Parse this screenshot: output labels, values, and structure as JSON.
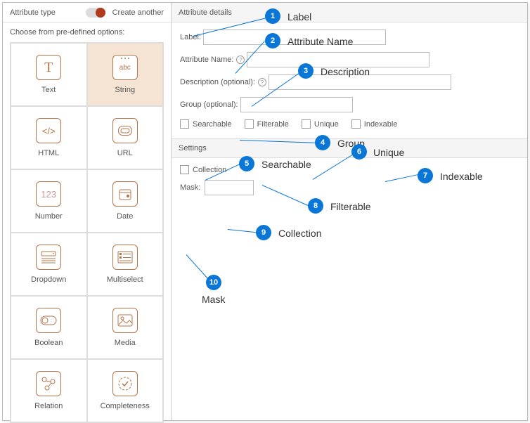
{
  "leftHeader": {
    "title": "Attribute type",
    "createAnother": "Create another"
  },
  "leftSub": "Choose from pre-defined options:",
  "types": [
    {
      "label": "Text"
    },
    {
      "label": "String"
    },
    {
      "label": "HTML"
    },
    {
      "label": "URL"
    },
    {
      "label": "Number"
    },
    {
      "label": "Date"
    },
    {
      "label": "Dropdown"
    },
    {
      "label": "Multiselect"
    },
    {
      "label": "Boolean"
    },
    {
      "label": "Media"
    },
    {
      "label": "Relation"
    },
    {
      "label": "Completeness"
    }
  ],
  "details": {
    "header": "Attribute details",
    "labelLabel": "Label:",
    "attrNameLabel": "Attribute Name:",
    "descLabel": "Description (optional):",
    "groupLabel": "Group (optional):",
    "checks": {
      "searchable": "Searchable",
      "filterable": "Filterable",
      "unique": "Unique",
      "indexable": "Indexable"
    }
  },
  "settings": {
    "header": "Settings",
    "collection": "Collection",
    "maskLabel": "Mask:"
  },
  "callouts": [
    {
      "n": "1",
      "label": "Label"
    },
    {
      "n": "2",
      "label": "Attribute Name"
    },
    {
      "n": "3",
      "label": "Description"
    },
    {
      "n": "4",
      "label": "Group"
    },
    {
      "n": "5",
      "label": "Searchable"
    },
    {
      "n": "6",
      "label": "Unique"
    },
    {
      "n": "7",
      "label": "Indexable"
    },
    {
      "n": "8",
      "label": "Filterable"
    },
    {
      "n": "9",
      "label": "Collection"
    },
    {
      "n": "10",
      "label": "Mask"
    }
  ]
}
